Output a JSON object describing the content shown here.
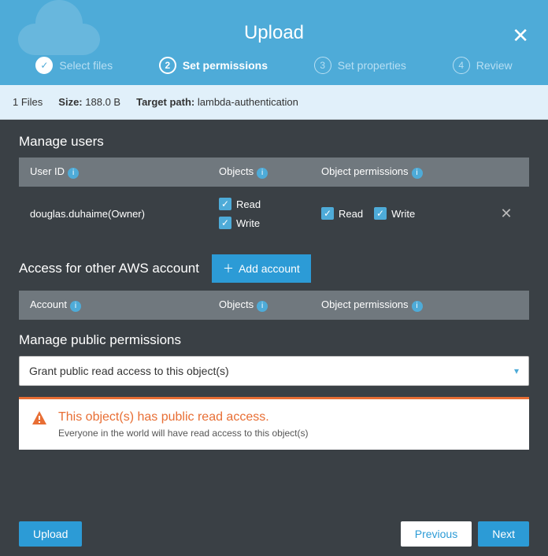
{
  "header": {
    "title": "Upload",
    "steps": [
      {
        "num": "✓",
        "label": "Select files",
        "state": "done"
      },
      {
        "num": "2",
        "label": "Set permissions",
        "state": "active"
      },
      {
        "num": "3",
        "label": "Set properties",
        "state": ""
      },
      {
        "num": "4",
        "label": "Review",
        "state": ""
      }
    ]
  },
  "infobar": {
    "files_count": "1 Files",
    "size_label": "Size:",
    "size_value": "188.0 B",
    "path_label": "Target path:",
    "path_value": "lambda-authentication"
  },
  "manage_users": {
    "title": "Manage users",
    "headers": {
      "col1": "User ID",
      "col2": "Objects",
      "col3": "Object permissions"
    },
    "user": "douglas.duhaime(Owner)",
    "obj_read": "Read",
    "obj_write": "Write",
    "perm_read": "Read",
    "perm_write": "Write"
  },
  "other_account": {
    "title": "Access for other AWS account",
    "add_btn": "Add account",
    "headers": {
      "col1": "Account",
      "col2": "Objects",
      "col3": "Object permissions"
    }
  },
  "public": {
    "title": "Manage public permissions",
    "selected": "Grant public read access to this object(s)"
  },
  "alert": {
    "title": "This object(s) has public read access.",
    "sub": "Everyone in the world will have read access to this object(s)"
  },
  "footer": {
    "upload": "Upload",
    "previous": "Previous",
    "next": "Next"
  }
}
